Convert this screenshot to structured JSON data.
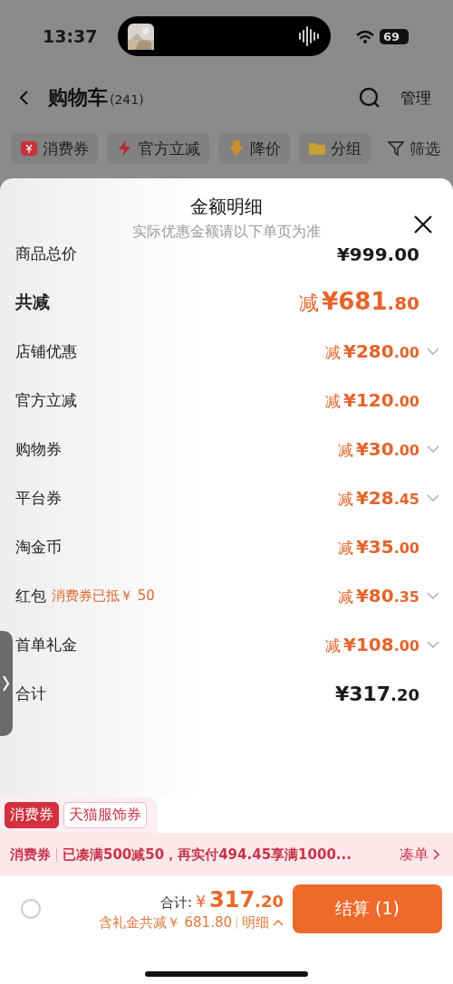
{
  "status_bar": {
    "time": "13:37",
    "battery": "69"
  },
  "header": {
    "title": "购物车",
    "count": "(241)",
    "manage": "管理"
  },
  "filters": [
    {
      "label": "消费券",
      "kind": "coupon"
    },
    {
      "label": "官方立减",
      "kind": "bolt"
    },
    {
      "label": "降价",
      "kind": "down"
    },
    {
      "label": "分组",
      "kind": "folder"
    },
    {
      "label": "筛选",
      "kind": "filter"
    }
  ],
  "sheet": {
    "title": "金额明细",
    "subtitle": "实际优惠金额请以下单页为准",
    "rows": [
      {
        "kind": "plain",
        "label": "商品总价",
        "amount": "¥999.00"
      },
      {
        "kind": "headline",
        "label": "共减",
        "prefix": "减",
        "amount": "¥681",
        "cents": ".80"
      },
      {
        "kind": "discount",
        "label": "店铺优惠",
        "prefix": "减",
        "amount": "¥280",
        "cents": ".00",
        "expandable": true
      },
      {
        "kind": "discount",
        "label": "官方立减",
        "prefix": "减",
        "amount": "¥120",
        "cents": ".00",
        "expandable": false
      },
      {
        "kind": "discount",
        "label": "购物券",
        "prefix": "减",
        "amount": "¥30",
        "cents": ".00",
        "expandable": true
      },
      {
        "kind": "discount",
        "label": "平台券",
        "prefix": "减",
        "amount": "¥28",
        "cents": ".45",
        "expandable": true
      },
      {
        "kind": "discount",
        "label": "淘金币",
        "prefix": "减",
        "amount": "¥35",
        "cents": ".00",
        "expandable": false
      },
      {
        "kind": "discount",
        "label": "红包",
        "note": "消费券已抵￥ 50",
        "prefix": "减",
        "amount": "¥80",
        "cents": ".35",
        "expandable": true
      },
      {
        "kind": "discount",
        "label": "首单礼金",
        "prefix": "减",
        "amount": "¥108",
        "cents": ".00",
        "expandable": true
      },
      {
        "kind": "total",
        "label": "合计",
        "amount": "¥317",
        "cents": ".20"
      }
    ]
  },
  "coupon_tabs": [
    {
      "label": "消费券",
      "selected": true
    },
    {
      "label": "天猫服饰券",
      "selected": false
    }
  ],
  "banner": {
    "tag": "消费券",
    "text": "已凑满500减50，再实付494.45享满1000...",
    "action": "凑单"
  },
  "checkout": {
    "checked": false,
    "total_label": "合计:",
    "currency": "¥",
    "amount": "317",
    "cents": ".20",
    "saving": "含礼金共减￥ 681.80",
    "detail": "明细",
    "button": "结算 (1)"
  }
}
